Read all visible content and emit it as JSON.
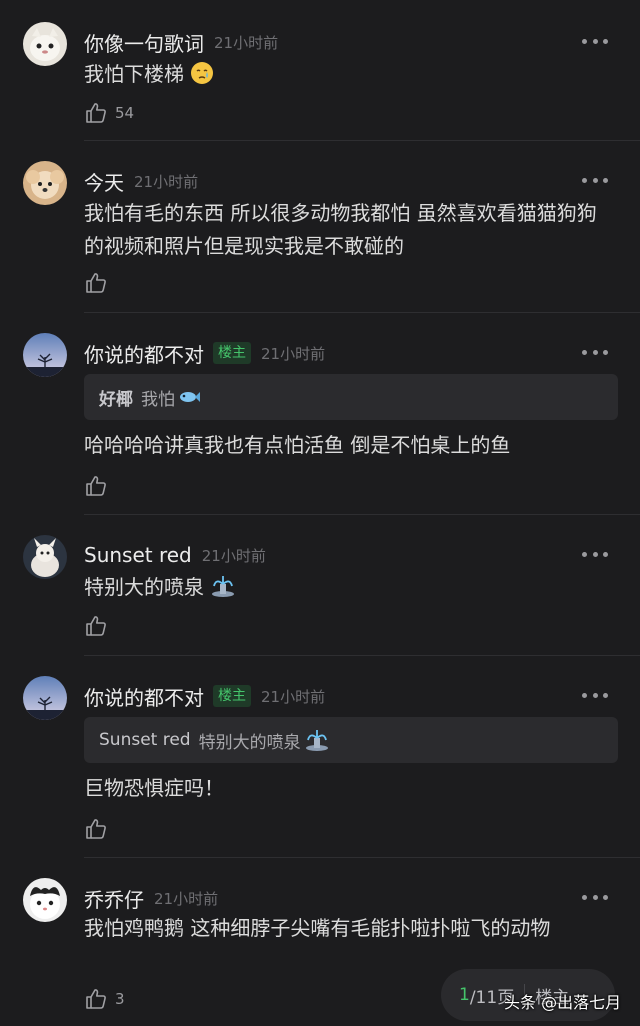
{
  "comments": [
    {
      "name": "你像一句歌词",
      "time": "21小时前",
      "text": "我怕下楼梯",
      "likes": "54"
    },
    {
      "name": "今天",
      "time": "21小时前",
      "text": "我怕有毛的东西 所以很多动物我都怕 虽然喜欢看猫猫狗狗的视频和照片但是现实我是不敢碰的",
      "likes": ""
    },
    {
      "name": "你说的都不对",
      "badge": "楼主",
      "time": "21小时前",
      "quote_name": "好椰",
      "quote_text": "我怕",
      "text": "哈哈哈哈讲真我也有点怕活鱼 倒是不怕桌上的鱼",
      "likes": ""
    },
    {
      "name": "Sunset red",
      "time": "21小时前",
      "text": "特别大的喷泉",
      "likes": ""
    },
    {
      "name": "你说的都不对",
      "badge": "楼主",
      "time": "21小时前",
      "quote_name": "Sunset red",
      "quote_text": "特别大的喷泉",
      "text": "巨物恐惧症吗！",
      "likes": ""
    },
    {
      "name": "乔乔仔",
      "time": "21小时前",
      "text": "我怕鸡鸭鹅 这种细脖子尖嘴有毛能扑啦扑啦飞的动物",
      "likes": "3"
    }
  ],
  "pager": {
    "current": "1",
    "total": "/11页",
    "menu": "楼主"
  },
  "watermark": "头条 @出落七月",
  "colors": {
    "background": "#1c1c1e",
    "accent_green": "#45c46b"
  }
}
